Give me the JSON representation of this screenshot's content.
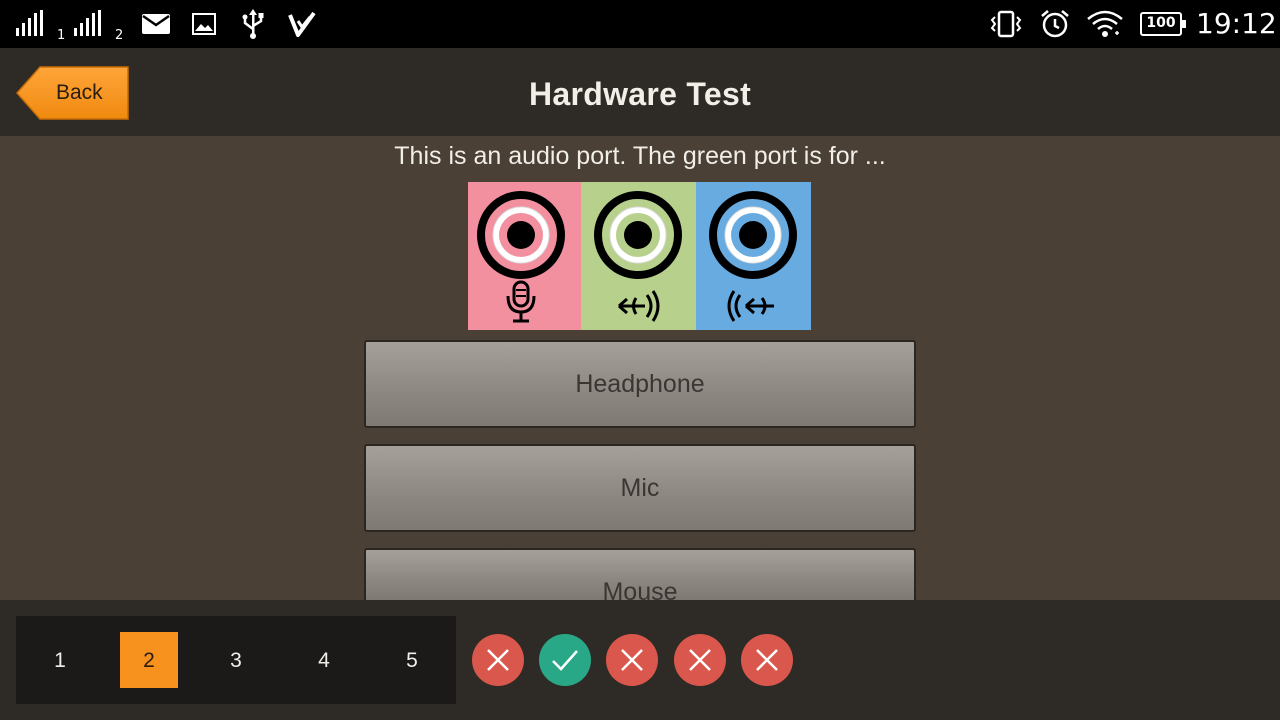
{
  "status_bar": {
    "sim1_label": "1",
    "sim2_label": "2",
    "battery": "100",
    "time": "19:12",
    "icons": [
      "signal-icon",
      "signal-icon",
      "mail-icon",
      "image-icon",
      "usb-icon",
      "download-check-icon",
      "vibrate-icon",
      "alarm-icon",
      "wifi-icon",
      "battery-icon"
    ]
  },
  "header": {
    "back_label": "Back",
    "title": "Hardware Test"
  },
  "question": {
    "text": "This is an audio port. The green port is for ...",
    "image_ports": [
      {
        "color": "#f290a0",
        "icon": "microphone-icon"
      },
      {
        "color": "#b7d08c",
        "icon": "line-out-icon"
      },
      {
        "color": "#68abe0",
        "icon": "line-in-icon"
      }
    ]
  },
  "answers": [
    {
      "label": "Headphone"
    },
    {
      "label": "Mic"
    },
    {
      "label": "Mouse"
    }
  ],
  "navigation": {
    "questions": [
      "1",
      "2",
      "3",
      "4",
      "5"
    ],
    "current": "2",
    "results": [
      "wrong",
      "right",
      "wrong",
      "wrong",
      "wrong"
    ]
  },
  "colors": {
    "accent": "#f7921e",
    "correct": "#29a887",
    "incorrect": "#d9574c",
    "background": "#4a4036",
    "header_bg": "#2e2a25"
  }
}
